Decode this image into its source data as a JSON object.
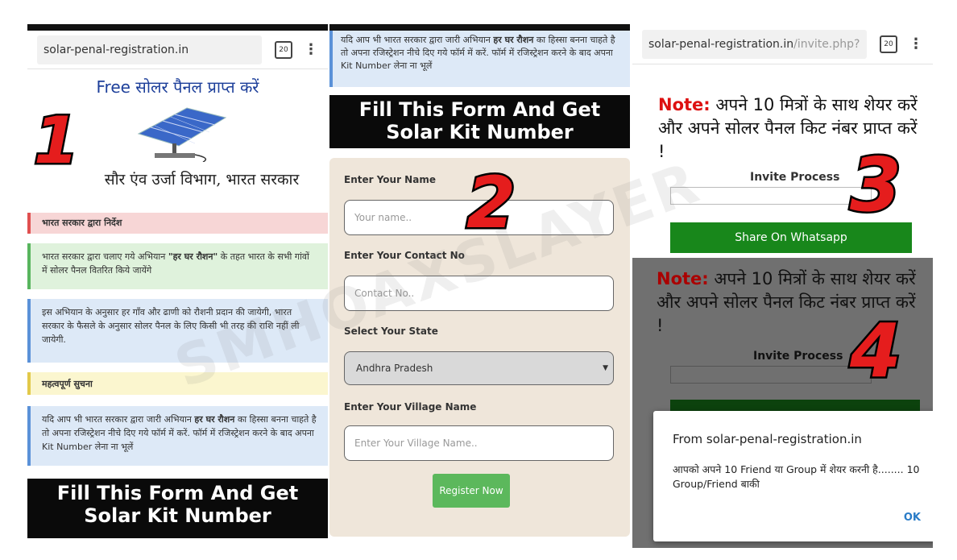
{
  "panel1": {
    "url": "solar-penal-registration.in",
    "tab_count": "20",
    "menu_glyph": "⋮",
    "banner_free": "Free",
    "banner_title": "सोलर पैनल प्राप्त करें",
    "banner_dept": "सौर एंव उर्जा विभाग, भारत सरकार",
    "step_number": "1",
    "notice_heading": "भारत सरकार द्वारा निर्देश",
    "green_text_a": "भारत सरकार द्वारा चलाए गये अभियान ",
    "green_text_bold": "\"हर घर रौशन\"",
    "green_text_b": " के तहत भारत के सभी गांवों में सोलर पैनल वितरित किये जायेंगे",
    "blue_text": "इस अभियान के अनुसार हर गाँव और ढाणी को रौशनी प्रदान की जायेगी, भारत सरकार के फैसले के अनुसार सोलर पैनल के लिए किसी भी तरह की राशि नहीं ली जायेगी.",
    "important_heading": "महत्वपूर्ण सुचना",
    "blue2_text_a": "यदि आप भी भारत सरकार द्वारा जारी अभियान ",
    "blue2_text_bold": "हर घर रौशन",
    "blue2_text_b": " का हिस्सा बनना चाहते है तो अपना रजिस्ट्रेशन नीचे दिए गये फॉर्म में करें. फॉर्म में रजिस्ट्रेशन करने के बाद अपना Kit Number लेना ना भूलें",
    "form_heading": "Fill This Form And Get Solar Kit Number"
  },
  "panel2": {
    "top_text_a": "यदि आप भी भारत सरकार द्वारा जारी अभियान ",
    "top_text_bold": "हर घर रौशन",
    "top_text_b": " का हिस्सा बनना चाहते है तो अपना रजिस्ट्रेशन नीचे दिए गये फॉर्म में करें. फॉर्म में रजिस्ट्रेशन करने के बाद अपना Kit Number लेना ना भूलें",
    "form_heading": "Fill This Form And Get Solar Kit Number",
    "step_number": "2",
    "name_label": "Enter Your Name",
    "name_placeholder": "Your name..",
    "contact_label": "Enter Your Contact No",
    "contact_placeholder": "Contact No..",
    "state_label": "Select Your State",
    "state_value": "Andhra Pradesh",
    "village_label": "Enter Your Village Name",
    "village_placeholder": "Enter Your Village Name..",
    "register_button": "Register Now"
  },
  "panel3": {
    "url_domain": "solar-penal-registration.in",
    "url_path": "/invite.php?",
    "tab_count": "20",
    "menu_glyph": "⋮",
    "note_label": "Note:",
    "note_text": " अपने 10 मित्रों के साथ शेयर करें और अपने सोलर पैनल किट नंबर प्राप्त करें !",
    "invite_process": "Invite Process",
    "share_button": "Share On Whatsapp",
    "step_number": "3"
  },
  "panel4": {
    "note_label": "Note:",
    "note_text": " अपने 10 मित्रों के साथ शेयर करें और अपने सोलर पैनल किट नंबर प्राप्त करें !",
    "invite_process": "Invite Process",
    "dialog_title": "From solar-penal-registration.in",
    "dialog_message": "आपको अपने 10 Friend या Group में शेयर करनी है........ 10 Group/Friend बाकी",
    "ok_button": "OK",
    "step_number": "4"
  },
  "watermark": "SMHOAXSLAYER",
  "colors": {
    "step_number_red": "#e51d1d",
    "note_red": "#d11111",
    "whatsapp_green": "#18871b",
    "register_green": "#5cb85c",
    "banner_blue": "#1d3f9a"
  }
}
